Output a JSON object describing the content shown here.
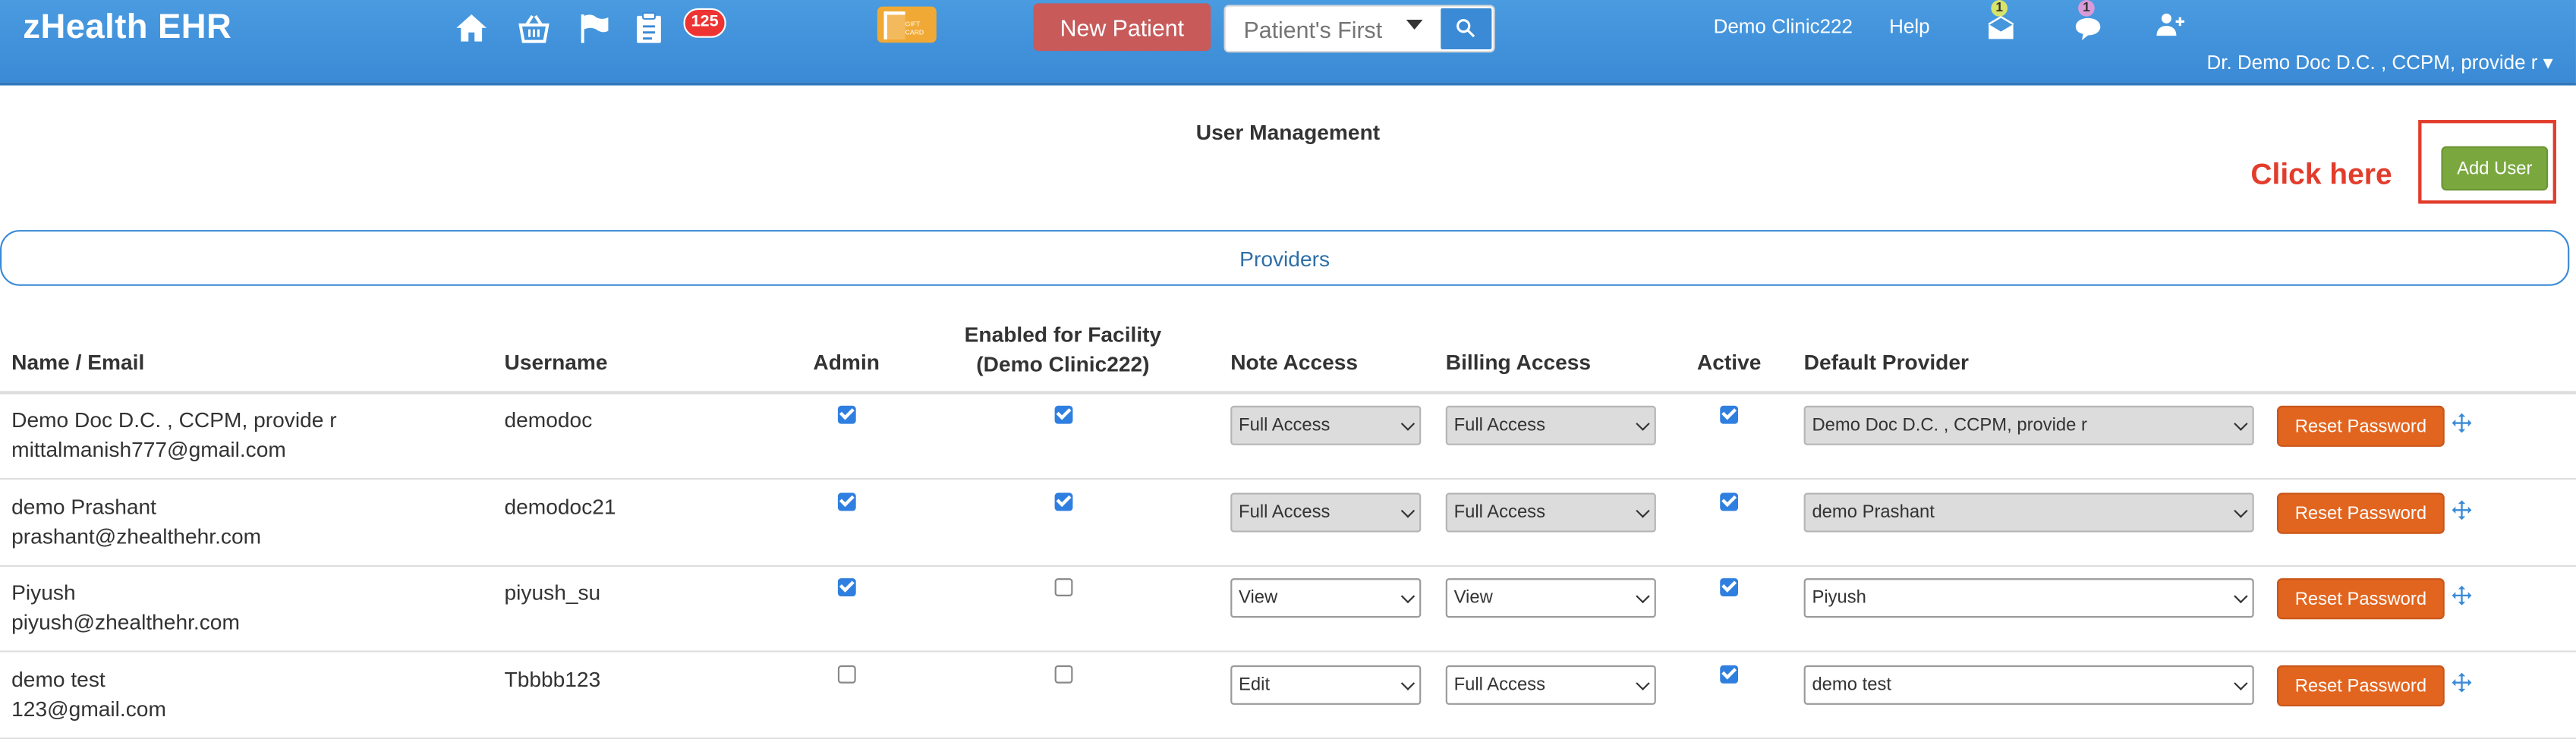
{
  "app": {
    "title": "zHealth EHR",
    "notification_count": "125",
    "new_patient_label": "New Patient",
    "search_placeholder": "Patient's First",
    "clinic_link": "Demo Clinic222",
    "help_link": "Help",
    "mail_badge": "1",
    "chat_badge": "1",
    "user_name": "Dr. Demo Doc D.C. , CCPM, provide r"
  },
  "page": {
    "title": "User Management",
    "annotation": "Click here",
    "add_user_label": "Add User",
    "section_label": "Providers"
  },
  "table": {
    "headers": {
      "name_email": "Name / Email",
      "username": "Username",
      "admin": "Admin",
      "enabled_line1": "Enabled for Facility",
      "enabled_line2": "(Demo Clinic222)",
      "note_access": "Note Access",
      "billing_access": "Billing Access",
      "active": "Active",
      "default_provider": "Default Provider"
    },
    "reset_label": "Reset Password",
    "rows": [
      {
        "name": "Demo Doc D.C. , CCPM, provide r",
        "email": "mittalmanish777@gmail.com",
        "username": "demodoc",
        "admin": true,
        "enabled": true,
        "note": "Full Access",
        "billing": "Full Access",
        "active": true,
        "provider": "Demo Doc D.C. , CCPM, provide r",
        "locked": true
      },
      {
        "name": "demo Prashant",
        "email": "prashant@zhealthehr.com",
        "username": "demodoc21",
        "admin": true,
        "enabled": true,
        "note": "Full Access",
        "billing": "Full Access",
        "active": true,
        "provider": "demo Prashant",
        "locked": true
      },
      {
        "name": "Piyush",
        "email": "piyush@zhealthehr.com",
        "username": "piyush_su",
        "admin": true,
        "enabled": false,
        "note": "View",
        "billing": "View",
        "active": true,
        "provider": "Piyush",
        "locked": false
      },
      {
        "name": "demo test",
        "email": "123@gmail.com",
        "username": "Tbbbb123",
        "admin": false,
        "enabled": false,
        "note": "Edit",
        "billing": "Full Access",
        "active": true,
        "provider": "demo test",
        "locked": false
      }
    ]
  },
  "colors": {
    "topbar": "#3a8ad6",
    "new_patient": "#c85a5a",
    "add_user": "#7aa83f",
    "reset": "#e2651f",
    "annotation": "#e23c2c",
    "checkbox": "#2f7fe0"
  }
}
